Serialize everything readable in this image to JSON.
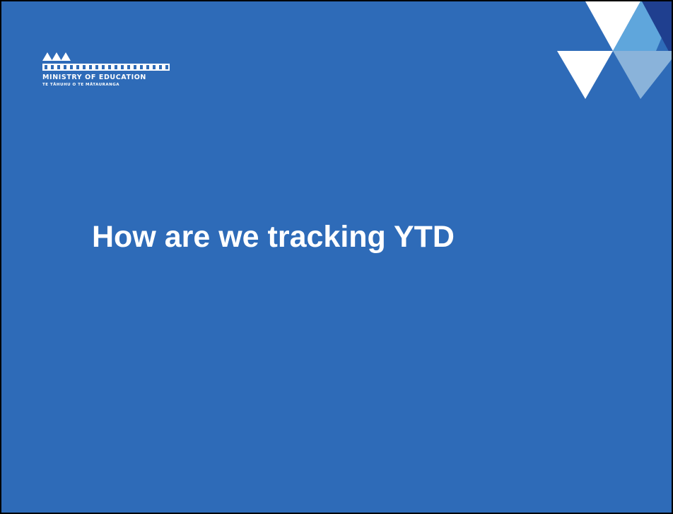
{
  "slide": {
    "background_color": "#2e6bb8",
    "title": "How are we tracking YTD"
  },
  "logo": {
    "icon": "ministry-of-education-koru-icon",
    "name": "MINISTRY OF EDUCATION",
    "maori_name": "TE TĀHUHU O TE MĀTAURANGA"
  },
  "decoration": {
    "icon": "triangles-motif-icon",
    "colors": [
      "#ffffff",
      "#5fa6dc",
      "#1f3f8f",
      "#8ab3da"
    ]
  }
}
